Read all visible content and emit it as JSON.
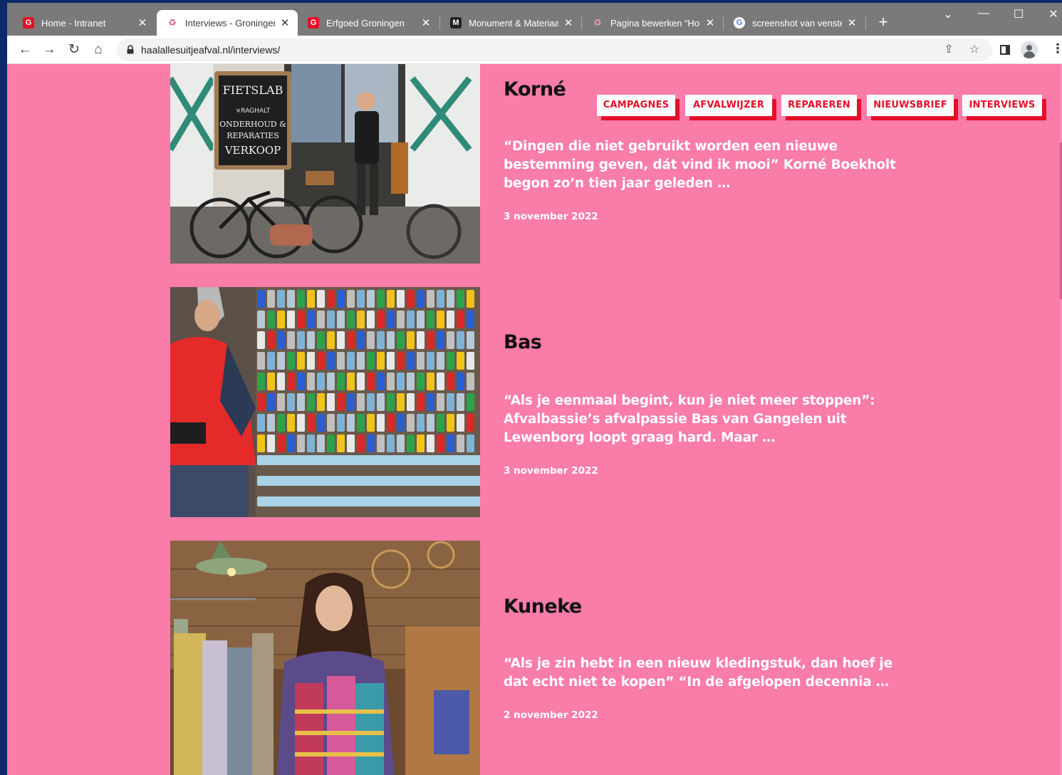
{
  "browser": {
    "tabs": [
      {
        "title": "Home - Intranet",
        "favicon": "G",
        "favicon_color": "#e60f2a",
        "active": false
      },
      {
        "title": "Interviews - Groningen",
        "favicon": "♻",
        "favicon_color": "#e8556e",
        "active": true
      },
      {
        "title": "Erfgoed Groningen",
        "favicon": "G",
        "favicon_color": "#e60f2a",
        "active": false
      },
      {
        "title": "Monument & Materiaal",
        "favicon": "M",
        "favicon_color": "#222222",
        "active": false
      },
      {
        "title": "Pagina bewerken “Home”",
        "favicon": "♻",
        "favicon_color": "#e8556e",
        "active": false
      },
      {
        "title": "screenshot van venster",
        "favicon": "G",
        "favicon_color": "#4285f4",
        "active": false
      }
    ],
    "tab_close_glyph": "✕",
    "new_tab_glyph": "+",
    "window_controls": {
      "dropdown": "⌄",
      "minimize": "—",
      "maximize": "☐",
      "close": "✕"
    },
    "toolbar": {
      "back": "←",
      "forward": "→",
      "reload": "↻",
      "home": "⌂",
      "url": "haalallesuitjeafval.nl/interviews/",
      "share": "⇪",
      "bookmark": "☆",
      "menu": "⋮"
    }
  },
  "site": {
    "nav": [
      "CAMPAGNES",
      "AFVALWIJZER",
      "REPAREREN",
      "NIEUWSBRIEF",
      "INTERVIEWS"
    ],
    "accent_color": "#e60f2a",
    "background_color": "#f97ca9",
    "interviews": [
      {
        "name": "Korné",
        "excerpt": "“Dingen die niet gebruikt worden een nieuwe bestemming geven, dát vind ik mooi” Korné Boekholt begon zo’n tien jaar geleden …",
        "date": "3 november 2022",
        "photo_sign": {
          "lines": [
            "FIETSLAB",
            "×RAGHALT",
            "ONDERHOUD &",
            "REPARATIES",
            "VERKOOP"
          ]
        }
      },
      {
        "name": "Bas",
        "excerpt": "“Als je eenmaal begint, kun je niet meer stoppen”: Afvalbassie’s afvalpassie Bas van Gangelen uit Lewenborg loopt graag hard. Maar …",
        "date": "3 november 2022"
      },
      {
        "name": "Kuneke",
        "excerpt": "“Als je zin hebt in een nieuw kledingstuk, dan hoef je dat echt niet te kopen” “In de afgelopen decennia …",
        "date": "2 november 2022"
      }
    ]
  }
}
